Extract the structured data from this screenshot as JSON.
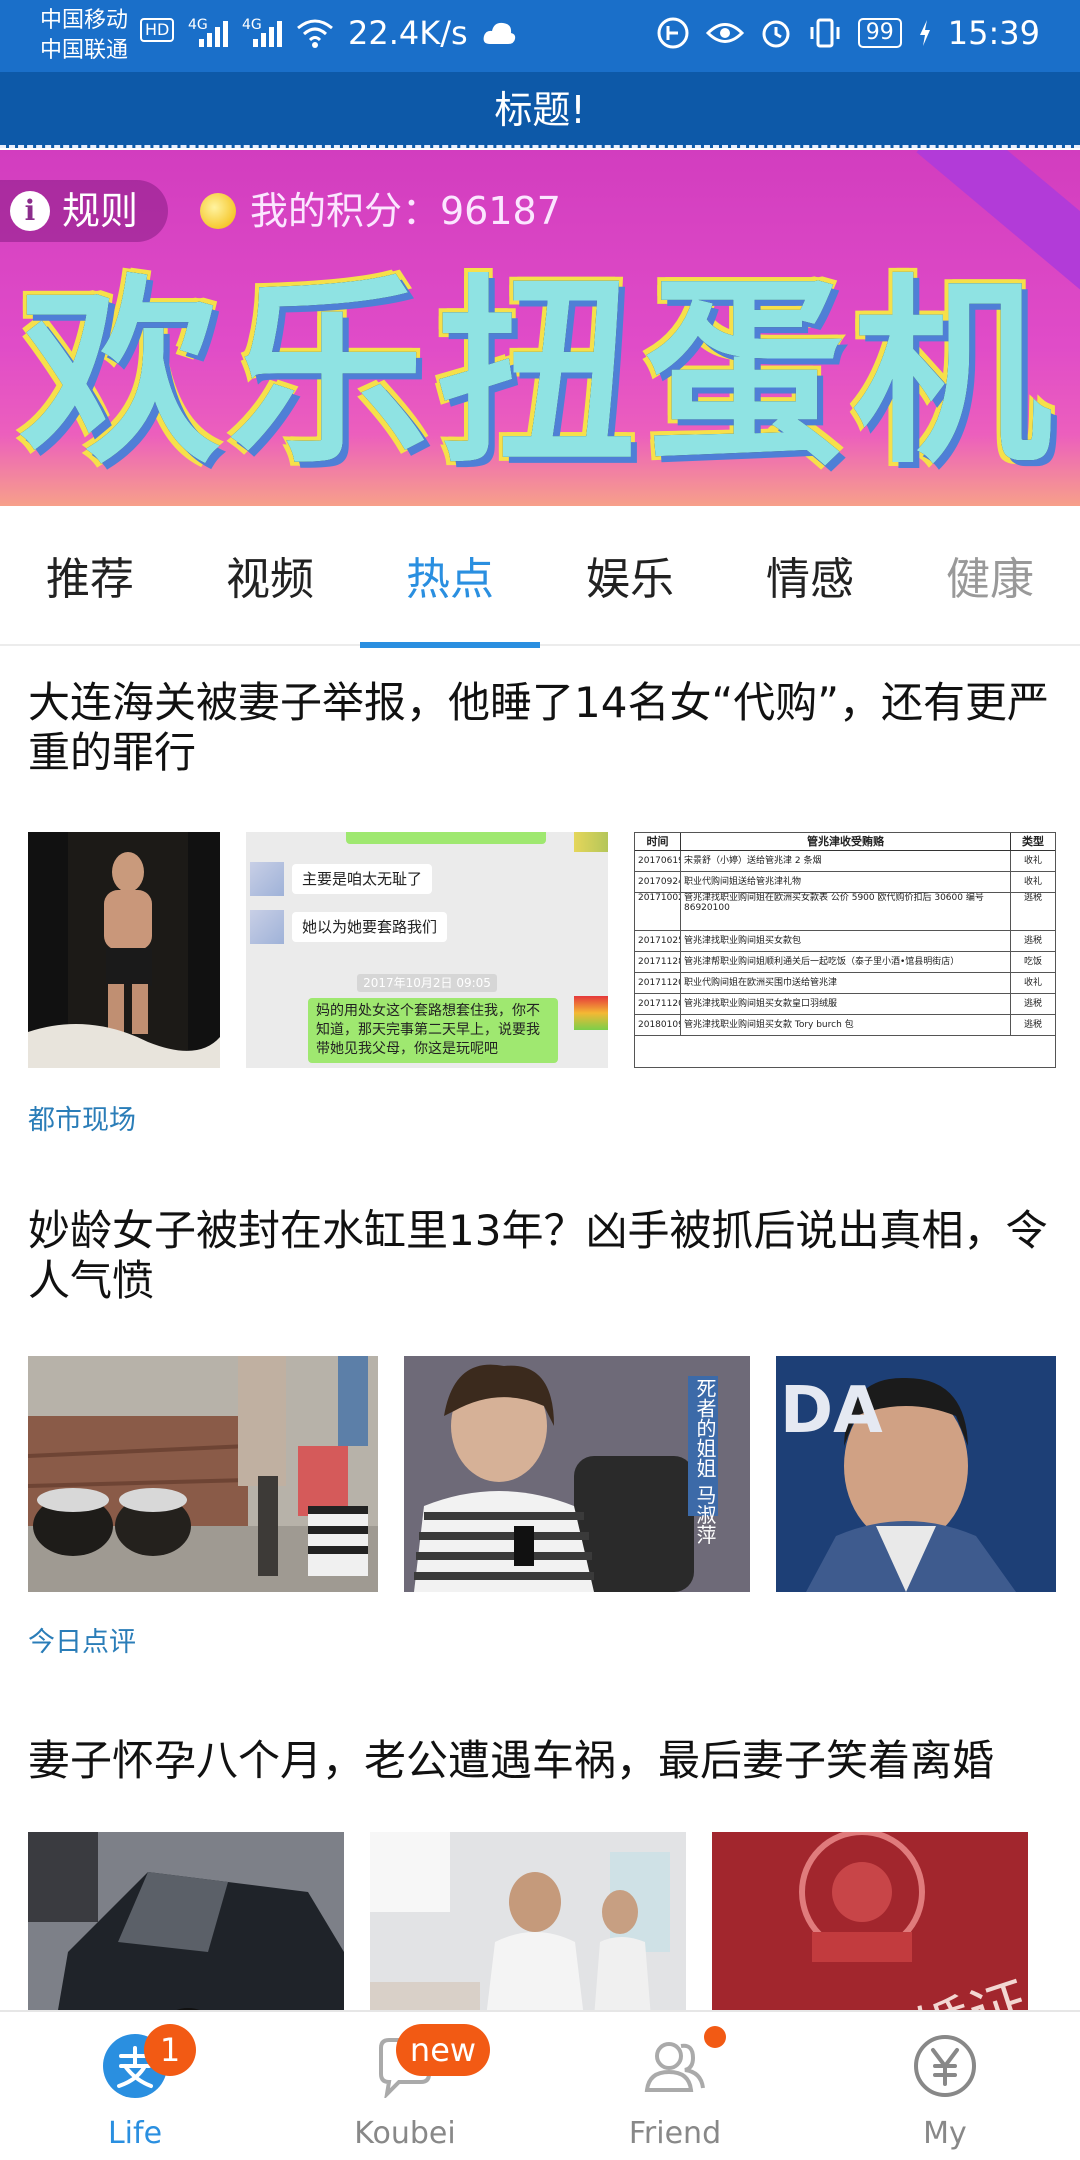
{
  "status_bar": {
    "carrier_1": "中国移动",
    "carrier_2": "中国联通",
    "hd_label": "HD",
    "signal_1": "4G",
    "signal_2": "4G",
    "net_speed": "22.4K/s",
    "battery": "99",
    "time": "15:39"
  },
  "header": {
    "title": "标题!"
  },
  "banner": {
    "rules_label": "规则",
    "points_label": "我的积分：96187",
    "headline": "欢乐扭蛋机"
  },
  "tabs": [
    {
      "label": "推荐"
    },
    {
      "label": "视频"
    },
    {
      "label": "热点",
      "active": true
    },
    {
      "label": "娱乐"
    },
    {
      "label": "情感"
    },
    {
      "label": "健康"
    }
  ],
  "articles": [
    {
      "title": "大连海关被妻子举报，他睡了14名女“代购”，还有更严重的罪行",
      "source": "都市现场",
      "chat": {
        "lines": [
          "主要是咱太无耻了",
          "她以为她要套路我们"
        ],
        "timestamp": "2017年10月2日 09:05",
        "reply": "妈的用处女这个套路想套住我，你不知道，那天完事第二天早上，说要我带她见我父母，你这是玩呢吧"
      },
      "table": {
        "headers": [
          "时间",
          "管兆津收受贿赂",
          "类型"
        ],
        "rows": [
          [
            "20170619",
            "宋景舒（小婷）送给管兆津 2 条烟",
            "收礼"
          ],
          [
            "20170924",
            "职业代购间姐送给管兆津礼物",
            "收礼"
          ],
          [
            "20171002",
            "管兆津找职业购间姐在欧洲买女款表 公价 5900 欧代购价扣后 30600 编号 86920100",
            "逃税"
          ],
          [
            "20171025",
            "管兆津找职业购间姐买女款包",
            "逃税"
          ],
          [
            "20171128",
            "管兆津帮职业购间姐顺利通关后一起吃饭（泰子里小酒•馆县明街店）",
            "吃饭"
          ],
          [
            "20171120",
            "职业代购间姐在欧洲买围巾送给管兆津",
            "收礼"
          ],
          [
            "20171120",
            "管兆津找职业购间姐买女款皇口羽绒服",
            "逃税"
          ],
          [
            "20180109",
            "管兆津找职业购间姐买女款 Tory burch 包",
            "逃税"
          ]
        ]
      }
    },
    {
      "title": "妙龄女子被封在水缸里13年？凶手被抓后说出真相，令人气愤",
      "source": "今日点评",
      "overlay_text": "死者的姐姐 马淑萍",
      "wall_text": "DA"
    },
    {
      "title": "妻子怀孕八个月，老公遭遇车祸，最后妻子笑着离婚",
      "cert_text": "婚证"
    }
  ],
  "bottom_nav": [
    {
      "label": "Life",
      "icon": "life-icon",
      "badge": "1",
      "active": true
    },
    {
      "label": "Koubei",
      "icon": "koubei-icon",
      "badge": "new"
    },
    {
      "label": "Friend",
      "icon": "friend-icon",
      "dot": true
    },
    {
      "label": "My",
      "icon": "yen-icon"
    }
  ],
  "colors": {
    "status_bar": "#1a6fc9",
    "title_bar": "#0d59a8",
    "accent": "#2a8fe0",
    "badge": "#f25a14",
    "source_text": "#2a7db8"
  }
}
